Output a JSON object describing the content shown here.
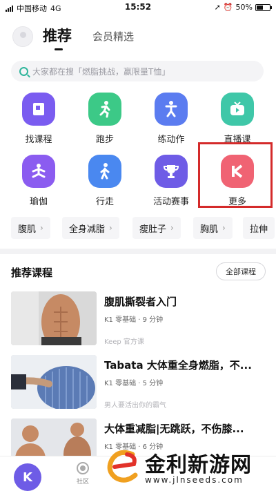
{
  "status_bar": {
    "carrier": "中国移动",
    "network": "4G",
    "time": "15:52",
    "battery": "50%",
    "battery_level": 0.5
  },
  "header": {
    "tab_active": "推荐",
    "tab_secondary": "会员精选"
  },
  "search": {
    "placeholder": "大家都在搜「燃脂挑战，赢限量T恤」",
    "accent": "#2fb59b"
  },
  "grid": [
    {
      "label": "找课程",
      "icon": "book-icon",
      "color": "#7a5cf0"
    },
    {
      "label": "跑步",
      "icon": "running-icon",
      "color": "#3cc987"
    },
    {
      "label": "练动作",
      "icon": "exercise-icon",
      "color": "#5b7cf0"
    },
    {
      "label": "直播课",
      "icon": "tv-icon",
      "color": "#3fc7a8"
    },
    {
      "label": "瑜伽",
      "icon": "yoga-icon",
      "color": "#8b5cf0"
    },
    {
      "label": "行走",
      "icon": "walking-icon",
      "color": "#4a88f0"
    },
    {
      "label": "活动赛事",
      "icon": "trophy-icon",
      "color": "#6e5ce6"
    },
    {
      "label": "更多",
      "icon": "keep-k-icon",
      "color": "#f06373"
    }
  ],
  "chips": [
    "腹肌",
    "全身减脂",
    "瘦肚子",
    "胸肌",
    "拉伸"
  ],
  "recommend": {
    "title": "推荐课程",
    "all_button": "全部课程",
    "courses": [
      {
        "title": "腹肌撕裂者入门",
        "meta": "K1 零基础 · 9 分钟",
        "source": "Keep 官方课"
      },
      {
        "title": "Tabata 大体重全身燃脂，不...",
        "meta": "K1 零基础 · 5 分钟",
        "source": "男人要活出你的霸气"
      },
      {
        "title": "大体重减脂|无跳跃，不伤膝...",
        "meta": "K1 零基础 · 6 分钟",
        "source": ""
      }
    ]
  },
  "bottom_nav": {
    "home_letter": "K",
    "community": "社区"
  },
  "watermark": {
    "title": "金利新游网",
    "url": "www.jlnseeds.com"
  }
}
